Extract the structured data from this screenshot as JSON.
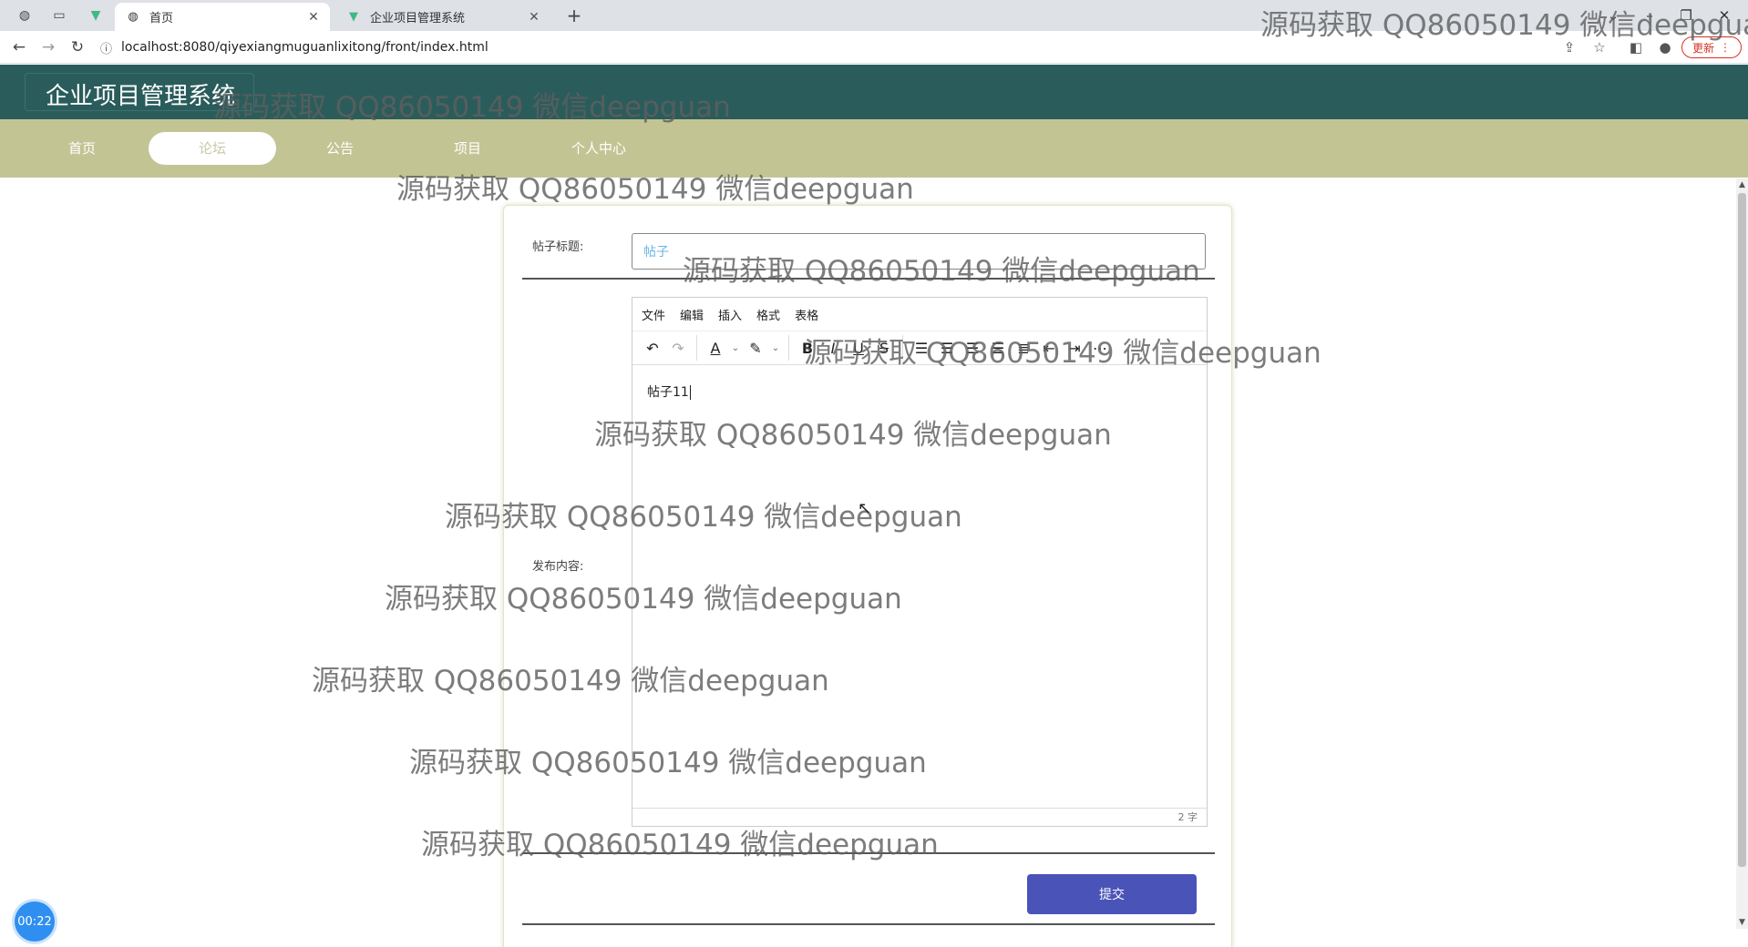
{
  "browser": {
    "tabs": [
      {
        "label": "首页",
        "icon": "globe-icon"
      },
      {
        "label": "企业项目管理系统",
        "icon": "vue-logo-icon"
      }
    ],
    "url": "localhost:8080/qiyexiangmuguanlixitong/front/index.html",
    "update_label": "更新"
  },
  "site": {
    "title": "企业项目管理系统",
    "nav": [
      "首页",
      "论坛",
      "公告",
      "项目",
      "个人中心"
    ],
    "active_nav": "论坛"
  },
  "form": {
    "title_label": "帖子标题:",
    "title_value": "帖子",
    "content_label": "发布内容:",
    "editor_menu": [
      "文件",
      "编辑",
      "插入",
      "格式",
      "表格"
    ],
    "editor_content": "帖子11",
    "word_count": "2 字",
    "submit_label": "提交"
  },
  "timer": "00:22",
  "watermark": "源码获取 QQ86050149 微信deepguan",
  "colors": {
    "header": "#2b5c5c",
    "nav": "#c3c494",
    "submit": "#4a53b8",
    "input_text": "#6cb5e6"
  }
}
